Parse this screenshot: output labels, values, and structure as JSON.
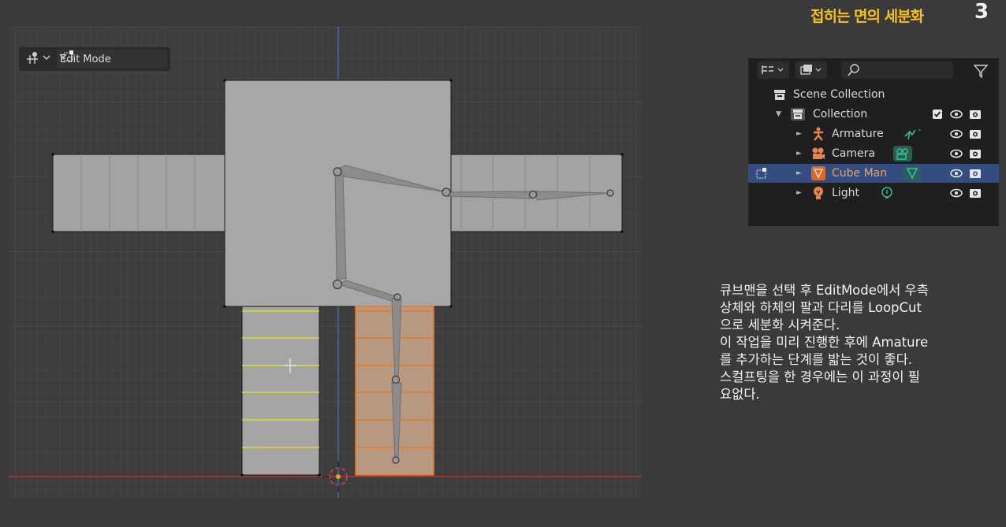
{
  "header": {
    "title": "접히는 면의 세분화",
    "page_number": "3"
  },
  "viewport": {
    "header": {
      "mode_label": "Edit Mode",
      "transform_icon": "transform-pivot-icon",
      "mode_icon": "edit-mode-icon"
    }
  },
  "outliner": {
    "search_placeholder": "",
    "rows": [
      {
        "label": "Scene Collection",
        "icon": "scene-collection-icon",
        "indent": 0
      },
      {
        "label": "Collection",
        "icon": "collection-icon",
        "indent": 1,
        "checkbox": true
      },
      {
        "label": "Armature",
        "icon": "armature-icon",
        "indent": 2,
        "data_icon": "armature-data-icon"
      },
      {
        "label": "Camera",
        "icon": "camera-icon",
        "indent": 2,
        "data_icon": "camera-data-icon"
      },
      {
        "label": "Cube Man",
        "icon": "mesh-icon",
        "indent": 2,
        "data_icon": "mesh-data-icon",
        "selected": true
      },
      {
        "label": "Light",
        "icon": "light-icon",
        "indent": 2,
        "data_icon": "light-data-icon"
      }
    ]
  },
  "description": {
    "lines": [
      "큐브맨을 선택 후 EditMode에서 우측",
      "상체와 하체의 팔과 다리를 LoopCut",
      "으로 세분화 시켜준다.",
      "이 작업을 미리 진행한 후에 Amature",
      "를 추가하는 단계를 밟는 것이 좋다.",
      "스컬프팅을 한 경우에는 이 과정이 필",
      "요없다."
    ]
  },
  "colors": {
    "accent_title": "#f6c21a",
    "selected_row": "#334d80",
    "mesh_orange": "#e27a28",
    "loop_yellow": "#d8d83a",
    "x_axis": "#a8333b",
    "z_axis": "#3e68a8"
  }
}
